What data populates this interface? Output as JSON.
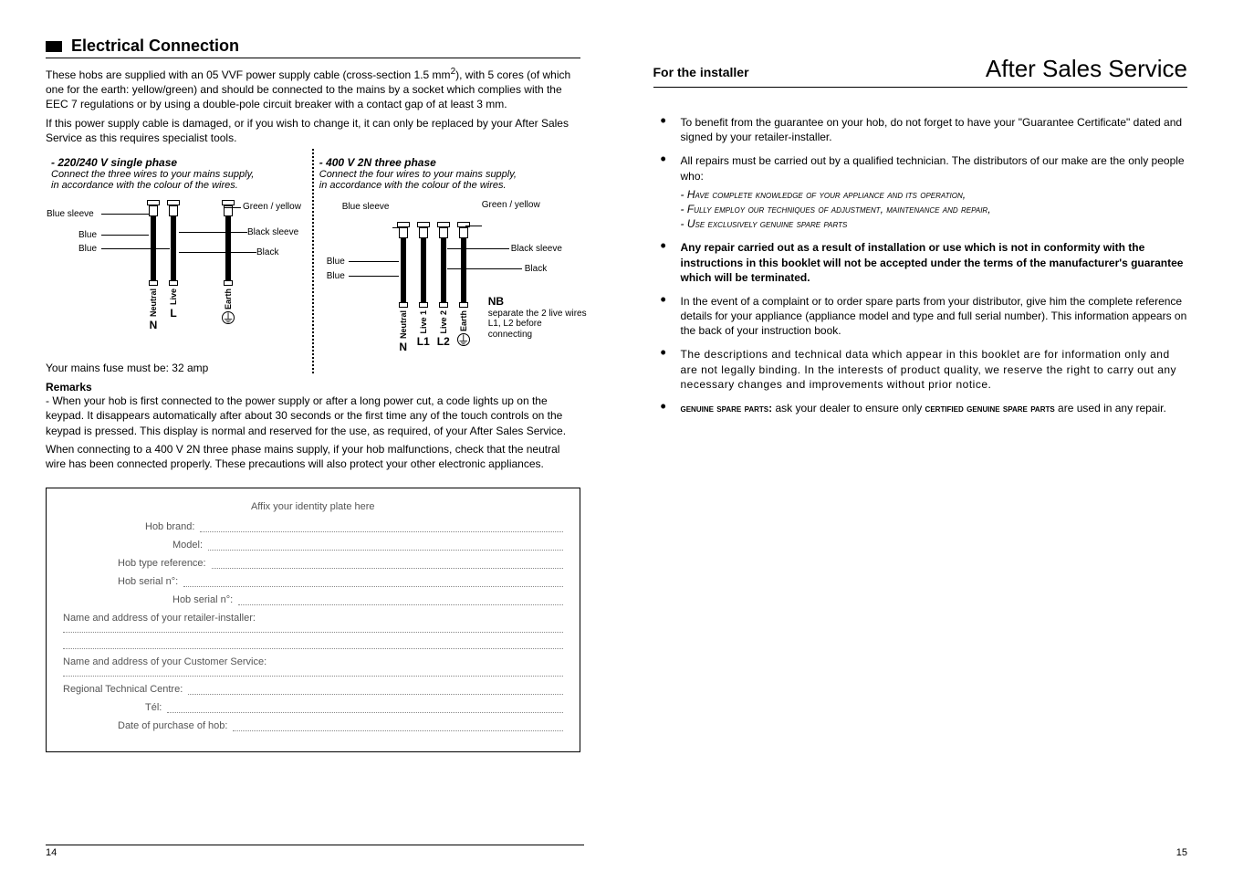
{
  "left": {
    "section_title": "Electrical Connection",
    "intro_p1_a": "These hobs are supplied with an 05 VVF power supply cable (cross-section 1.5 mm",
    "intro_p1_sup": "2",
    "intro_p1_b": "), with 5 cores (of which one for the earth: yellow/green) and should be connected to the mains by a socket which complies with the EEC 7 regulations or by using a double-pole circuit breaker with a contact gap of at least 3 mm.",
    "intro_p2": "If this power supply cable is damaged, or if you wish to change it, it can only be replaced by your After Sales Service as this requires specialist tools.",
    "single": {
      "heading": "- 220/240 V  single phase",
      "note1": "Connect the three wires to your mains supply,",
      "note2": "in accordance with the colour of the wires.",
      "labels": {
        "blue_sleeve": "Blue sleeve",
        "blue1": "Blue",
        "blue2": "Blue",
        "green_yellow": "Green / yellow",
        "black_sleeve": "Black sleeve",
        "black": "Black",
        "neutral": "Neutral",
        "live": "Live",
        "earth": "Earth",
        "N": "N",
        "L": "L"
      }
    },
    "three": {
      "heading": "- 400 V  2N three phase",
      "note1": "Connect the four wires to your mains supply,",
      "note2": "in accordance with the colour of the wires.",
      "labels": {
        "blue_sleeve": "Blue sleeve",
        "blue1": "Blue",
        "blue2": "Blue",
        "green_yellow": "Green / yellow",
        "black_sleeve": "Black sleeve",
        "black": "Black",
        "neutral": "Neutral",
        "live1": "Live 1",
        "live2": "Live 2",
        "earth": "Earth",
        "N": "N",
        "L1": "L1",
        "L2": "L2",
        "nb_head": "NB",
        "nb_body": "separate the 2 live wires L1, L2 before connecting"
      }
    },
    "fuse_line": "Your mains fuse must be: 32 amp",
    "remarks_title": "Remarks",
    "remarks_p1": " - When your hob is first connected to the power supply or after a long power cut, a code lights up on the keypad. It disappears automatically after about 30 seconds or the first time any of the touch controls on the keypad is pressed. This display is normal and reserved for the use, as required, of your After Sales Service.",
    "remarks_p2": "When connecting to a 400 V 2N three phase mains supply, if your hob malfunctions, check that the neutral wire has been connected properly. These precautions will also protect your other electronic appliances.",
    "idbox": {
      "l1": "Affix your identity plate here",
      "l2": "Hob brand:",
      "l3": "Model:",
      "l4": "Hob type reference:",
      "l5": "Hob serial n°:",
      "l6": "Hob serial n°:",
      "l7": "Name and address of your retailer-installer:",
      "l8": "Name and address of your Customer Service:",
      "l9": "Regional Technical Centre:",
      "l10": "Tél:",
      "l11": "Date of purchase of hob:"
    }
  },
  "right": {
    "header_small": "For the installer",
    "header_big": "After Sales Service",
    "bullets": {
      "b1": "To benefit from the guarantee on your hob, do not forget to have your \"Guarantee Certificate\" dated and signed by your retailer-installer.",
      "b2_lead": "All repairs must be carried out by a qualified technician. The distributors of our make are the only people who:",
      "b2_i1": "- Have complete knowledge of your appliance and its operation,",
      "b2_i2": "- Fully employ our techniques of adjustment, maintenance and repair,",
      "b2_i3": "- Use exclusively genuine spare parts",
      "b3": "Any repair carried out as a result of installation or use which is not in conformity with the instructions in this booklet will not be accepted under the terms of the manufacturer's guarantee which will be terminated.",
      "b4": "In the event of a complaint or to order spare parts from your distributor, give him the complete reference details for your appliance (appliance model and type and full serial number). This information appears on the back of your instruction book.",
      "b5": "The descriptions and technical data which appear in this booklet are for information only and are not legally binding. In the interests of product quality, we reserve the right to carry out any necessary changes and improvements without prior notice.",
      "b6_strong1": "genuine spare parts:",
      "b6_mid": " ask your dealer to ensure only ",
      "b6_strong2": "certified genuine spare parts",
      "b6_end": " are used in any repair."
    }
  },
  "pages": {
    "left": "14",
    "right": "15"
  }
}
